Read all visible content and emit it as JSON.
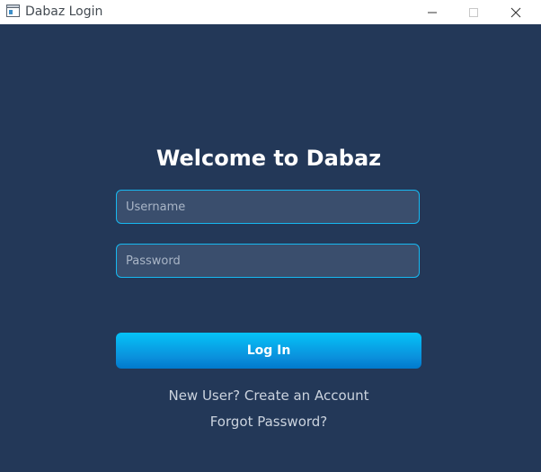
{
  "window": {
    "title": "Dabaz Login",
    "icon": "window-app-icon",
    "controls": {
      "minimize_icon": "minimize-icon",
      "maximize_icon": "maximize-icon",
      "close_icon": "close-icon"
    }
  },
  "login": {
    "heading": "Welcome to Dabaz",
    "username_placeholder": "Username",
    "username_value": "",
    "password_placeholder": "Password",
    "password_value": "",
    "login_button_label": "Log In",
    "create_account_link": "New User? Create an Account",
    "forgot_password_link": "Forgot Password?"
  },
  "colors": {
    "background": "#233858",
    "accent": "#0a8fdc",
    "field_border": "#17b8f0",
    "field_background": "#3a4e6d",
    "link_text": "#cbd3de"
  }
}
